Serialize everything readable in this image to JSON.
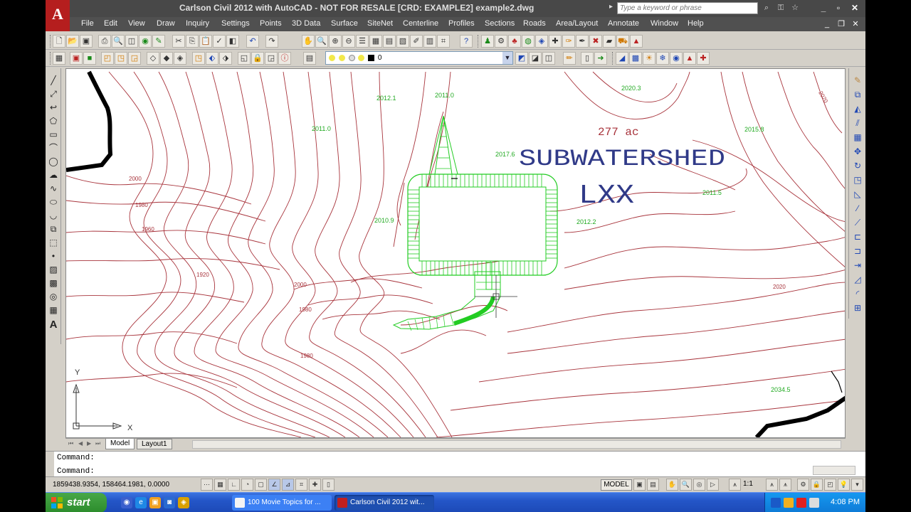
{
  "window": {
    "title": "Carlson Civil 2012 with AutoCAD - NOT FOR RESALE [CRD: EXAMPLE2]  example2.dwg",
    "logo": "A",
    "search_placeholder": "Type a keyword or phrase"
  },
  "menu": {
    "items": [
      "File",
      "Edit",
      "View",
      "Draw",
      "Inquiry",
      "Settings",
      "Points",
      "3D Data",
      "Surface",
      "SiteNet",
      "Centerline",
      "Profiles",
      "Sections",
      "Roads",
      "Area/Layout",
      "Annotate",
      "Window",
      "Help"
    ]
  },
  "layer": {
    "current": "0"
  },
  "drawing": {
    "title_line1": "SUBWATERSHED",
    "title_line2": "LXX",
    "area_label": "277 ac",
    "elevation_labels": [
      {
        "text": "2012.1"
      },
      {
        "text": "2011.0"
      },
      {
        "text": "2020.3"
      },
      {
        "text": "2011.0"
      },
      {
        "text": "2017.6"
      },
      {
        "text": "2015.8"
      },
      {
        "text": "2011.5"
      },
      {
        "text": "2010.9"
      },
      {
        "text": "2012.2"
      },
      {
        "text": "2034.5"
      }
    ],
    "contour_labels": [
      {
        "text": "2000"
      },
      {
        "text": "1980"
      },
      {
        "text": "1960"
      },
      {
        "text": "1920"
      },
      {
        "text": "2000"
      },
      {
        "text": "1980"
      },
      {
        "text": "1980"
      },
      {
        "text": "2020"
      },
      {
        "text": "2020"
      }
    ],
    "ucs": {
      "x": "X",
      "y": "Y"
    }
  },
  "tabs": {
    "items": [
      "Model",
      "Layout1"
    ]
  },
  "command": {
    "history": [
      "Command:",
      "Command:"
    ],
    "input": ""
  },
  "status": {
    "coords": "1859438.9354, 158464.1981, 0.0000",
    "model": "MODEL",
    "scale": "1:1"
  },
  "taskbar": {
    "start": "start",
    "tasks": [
      {
        "label": "100 Movie Topics for ..."
      },
      {
        "label": "Carlson Civil 2012 wit..."
      }
    ],
    "clock": "4:08 PM"
  }
}
